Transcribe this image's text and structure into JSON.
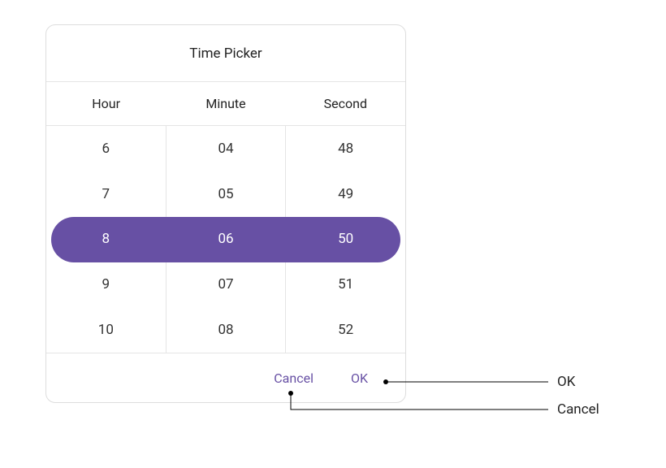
{
  "title": "Time Picker",
  "columns": {
    "hour": {
      "label": "Hour",
      "items": [
        "6",
        "7",
        "8",
        "9",
        "10"
      ],
      "selected": "8"
    },
    "minute": {
      "label": "Minute",
      "items": [
        "04",
        "05",
        "06",
        "07",
        "08"
      ],
      "selected": "06"
    },
    "second": {
      "label": "Second",
      "items": [
        "48",
        "49",
        "50",
        "51",
        "52"
      ],
      "selected": "50"
    }
  },
  "footer": {
    "cancel": "Cancel",
    "ok": "OK"
  },
  "callouts": {
    "ok": "OK",
    "cancel": "Cancel"
  },
  "accent": "#6750A4"
}
